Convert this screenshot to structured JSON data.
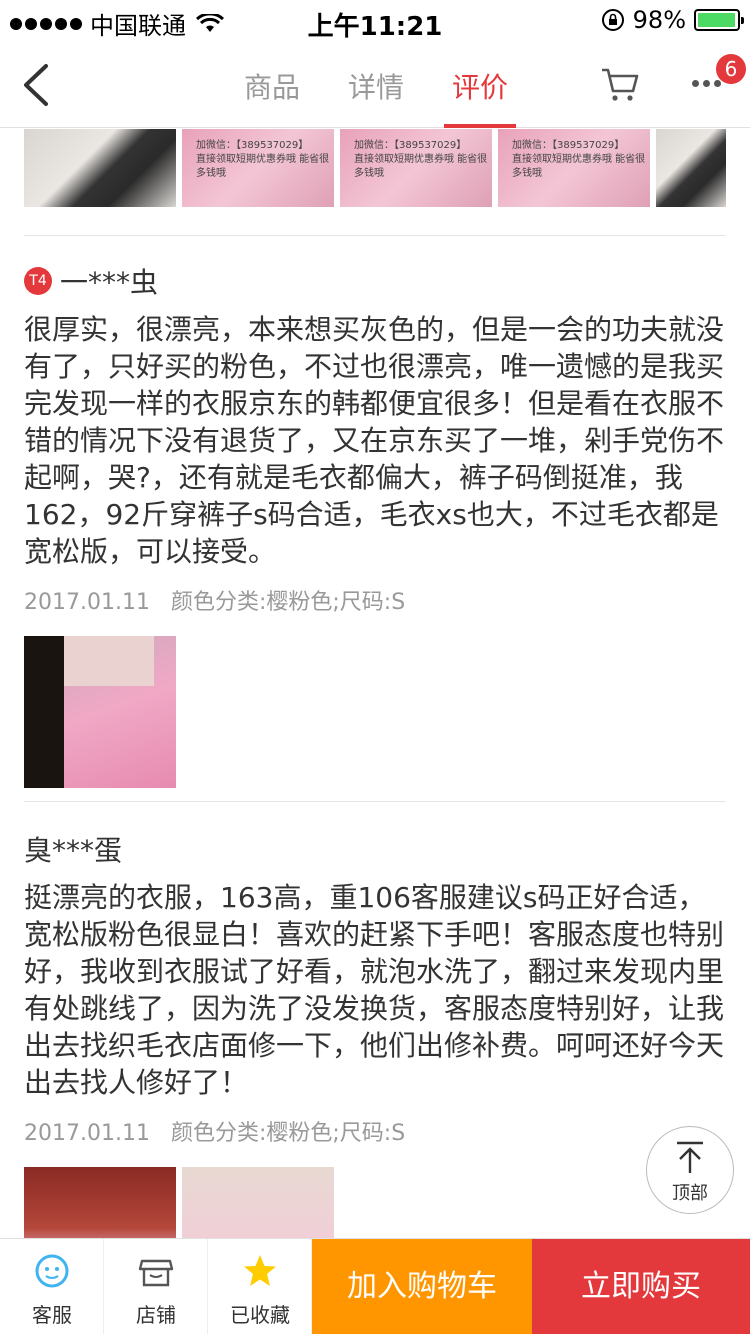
{
  "status_bar": {
    "carrier": "中国联通",
    "time": "上午11:21",
    "battery": "98%",
    "battery_level": 0.98
  },
  "nav": {
    "tabs": [
      {
        "label": "商品",
        "active": false
      },
      {
        "label": "详情",
        "active": false
      },
      {
        "label": "评价",
        "active": true
      }
    ],
    "more_badge": "6"
  },
  "top_photos": {
    "watermark_line1": "加微信：【389537029】",
    "watermark_line2": "直接领取短期优惠券哦 能省很多钱哦"
  },
  "reviews": [
    {
      "level_badge": "T4",
      "username": "一***虫",
      "text": "很厚实，很漂亮，本来想买灰色的，但是一会的功夫就没有了，只好买的粉色，不过也很漂亮，唯一遗憾的是我买完发现一样的衣服京东的韩都便宜很多！但是看在衣服不错的情况下没有退货了，又在京东买了一堆，剁手党伤不起啊，哭?，还有就是毛衣都偏大，裤子码倒挺准，我162，92斤穿裤子s码合适，毛衣xs也大，不过毛衣都是宽松版，可以接受。",
      "date": "2017.01.11",
      "spec": "颜色分类:樱粉色;尺码:S"
    },
    {
      "username": "臭***蛋",
      "text": "挺漂亮的衣服，163高，重106客服建议s码正好合适，宽松版粉色很显白！喜欢的赶紧下手吧！客服态度也特别好，我收到衣服试了好看，就泡水洗了，翻过来发现内里有处跳线了，因为洗了没发换货，客服态度特别好，让我出去找织毛衣店面修一下，他们出修补费。呵呵还好今天出去找人修好了！",
      "date": "2017.01.11",
      "spec": "颜色分类:樱粉色;尺码:S"
    }
  ],
  "back_to_top": "顶部",
  "bottom_bar": {
    "service": "客服",
    "store": "店铺",
    "favorited": "已收藏",
    "add_to_cart": "加入购物车",
    "buy_now": "立即购买"
  },
  "colors": {
    "accent": "#e4393c",
    "cart_orange": "#ff9600",
    "star_yellow": "#ffcc00",
    "service_blue": "#3fb4f0"
  }
}
